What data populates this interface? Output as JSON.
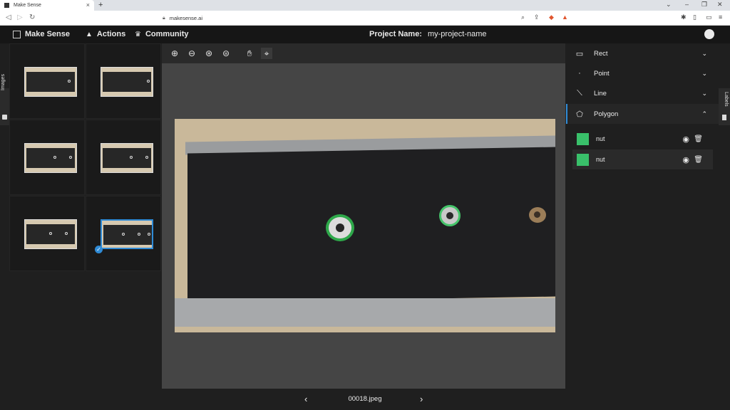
{
  "browser": {
    "tab_title": "Make Sense",
    "url": "makesense.ai",
    "new_tab_label": "+",
    "tab_close_label": "×"
  },
  "header": {
    "app_name": "Make Sense",
    "menu_actions": "Actions",
    "menu_community": "Community",
    "project_label": "Project Name:",
    "project_name": "my-project-name"
  },
  "left_tab": {
    "label": "Images"
  },
  "right_tab": {
    "label": "Labels"
  },
  "toolbar": {
    "zoom_in": "zoom-in-icon",
    "zoom_out": "zoom-out-icon",
    "zoom_fit": "zoom-fit-icon",
    "zoom_max": "zoom-max-icon",
    "hand": "hand-icon",
    "crosshair": "crosshair-icon"
  },
  "image_nav": {
    "filename": "00018.jpeg",
    "prev": "‹",
    "next": "›"
  },
  "label_types": [
    {
      "label": "Rect",
      "icon": "rect-icon",
      "expanded": false
    },
    {
      "label": "Point",
      "icon": "point-icon",
      "expanded": false
    },
    {
      "label": "Line",
      "icon": "line-icon",
      "expanded": false
    },
    {
      "label": "Polygon",
      "icon": "polygon-icon",
      "expanded": true
    }
  ],
  "polygon_labels": [
    {
      "name": "nut",
      "color": "#39c06a"
    },
    {
      "name": "nut",
      "color": "#39c06a"
    }
  ],
  "colors": {
    "accent": "#2f8bd6",
    "label_green": "#39c06a"
  }
}
